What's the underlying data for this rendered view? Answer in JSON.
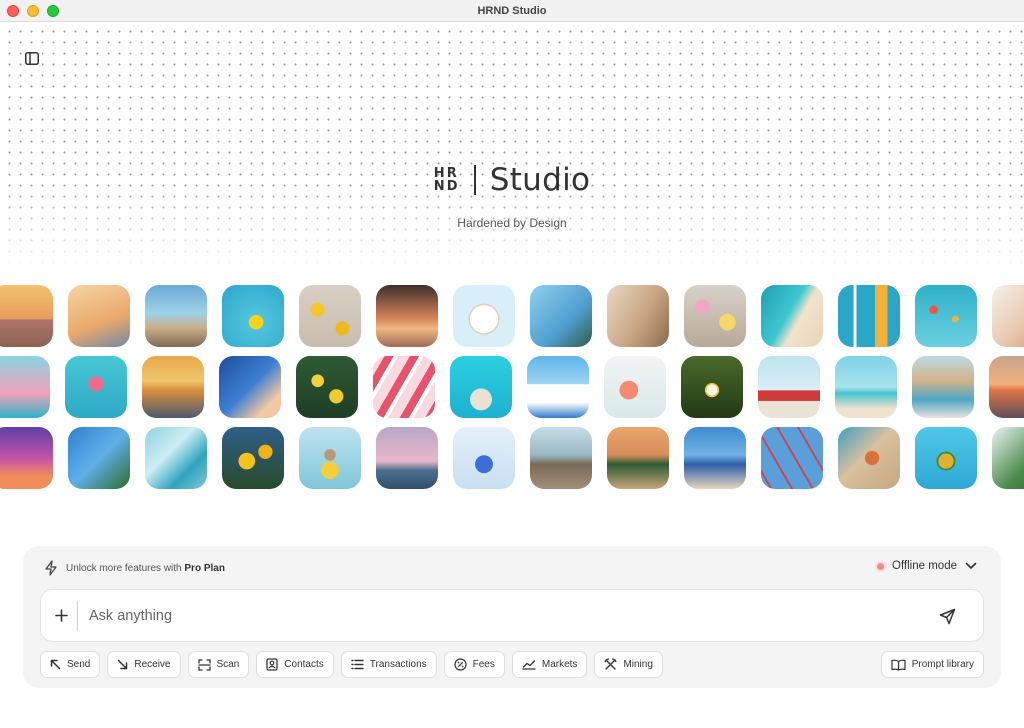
{
  "window": {
    "title": "HRND Studio"
  },
  "brand": {
    "logo_letters": [
      "H",
      "R",
      "N",
      "D"
    ],
    "name": "Studio",
    "tagline": "Hardened by Design"
  },
  "gallery": {
    "rows": [
      [
        "sunset-beach-car",
        "palm-silhouette",
        "boardwalk-beach",
        "pool-float-yellow",
        "lemons-sand",
        "palm-sunset-water",
        "ferris-wheel",
        "palm-sky",
        "palm-shadow-wall",
        "flowers-popsicles",
        "aerial-beach",
        "pool-drink",
        "hot-air-balloons",
        "drinks-tray"
      ],
      [
        "flamingo-float-partial",
        "flamingo-float",
        "beach-sunset",
        "palms-blue-sky",
        "lemon-tree",
        "watermelon-popsicles",
        "pool-hat",
        "blue-dome-greece",
        "grapefruit-drink",
        "daisy-field",
        "red-car-palms",
        "tropical-beach",
        "beach-hut",
        "sunset-horizon"
      ],
      [
        "purple-sunset-palms",
        "palms-looking-up",
        "striped-towel",
        "yellow-flowers",
        "dog-pool-float",
        "flamingo-pool-sunset",
        "blue-flower-sky",
        "pier-walkway",
        "palm-tree-beach",
        "beach-umbrellas",
        "ferris-wheel-close",
        "starfish-sand",
        "pineapple-pool",
        "palm-edge"
      ]
    ]
  },
  "composer": {
    "promo_text": "Unlock more features with",
    "promo_plan": "Pro Plan",
    "mode_label": "Offline mode",
    "mode_dot_color": "#f28b8b",
    "input_placeholder": "Ask anything",
    "chips": [
      {
        "label": "Send",
        "icon": "arrow-up-left-icon"
      },
      {
        "label": "Receive",
        "icon": "arrow-down-right-icon"
      },
      {
        "label": "Scan",
        "icon": "scan-icon"
      },
      {
        "label": "Contacts",
        "icon": "contacts-icon"
      },
      {
        "label": "Transactions",
        "icon": "list-icon"
      },
      {
        "label": "Fees",
        "icon": "percent-icon"
      },
      {
        "label": "Markets",
        "icon": "chart-line-icon"
      },
      {
        "label": "Mining",
        "icon": "mining-icon"
      }
    ],
    "prompt_library_label": "Prompt library"
  }
}
